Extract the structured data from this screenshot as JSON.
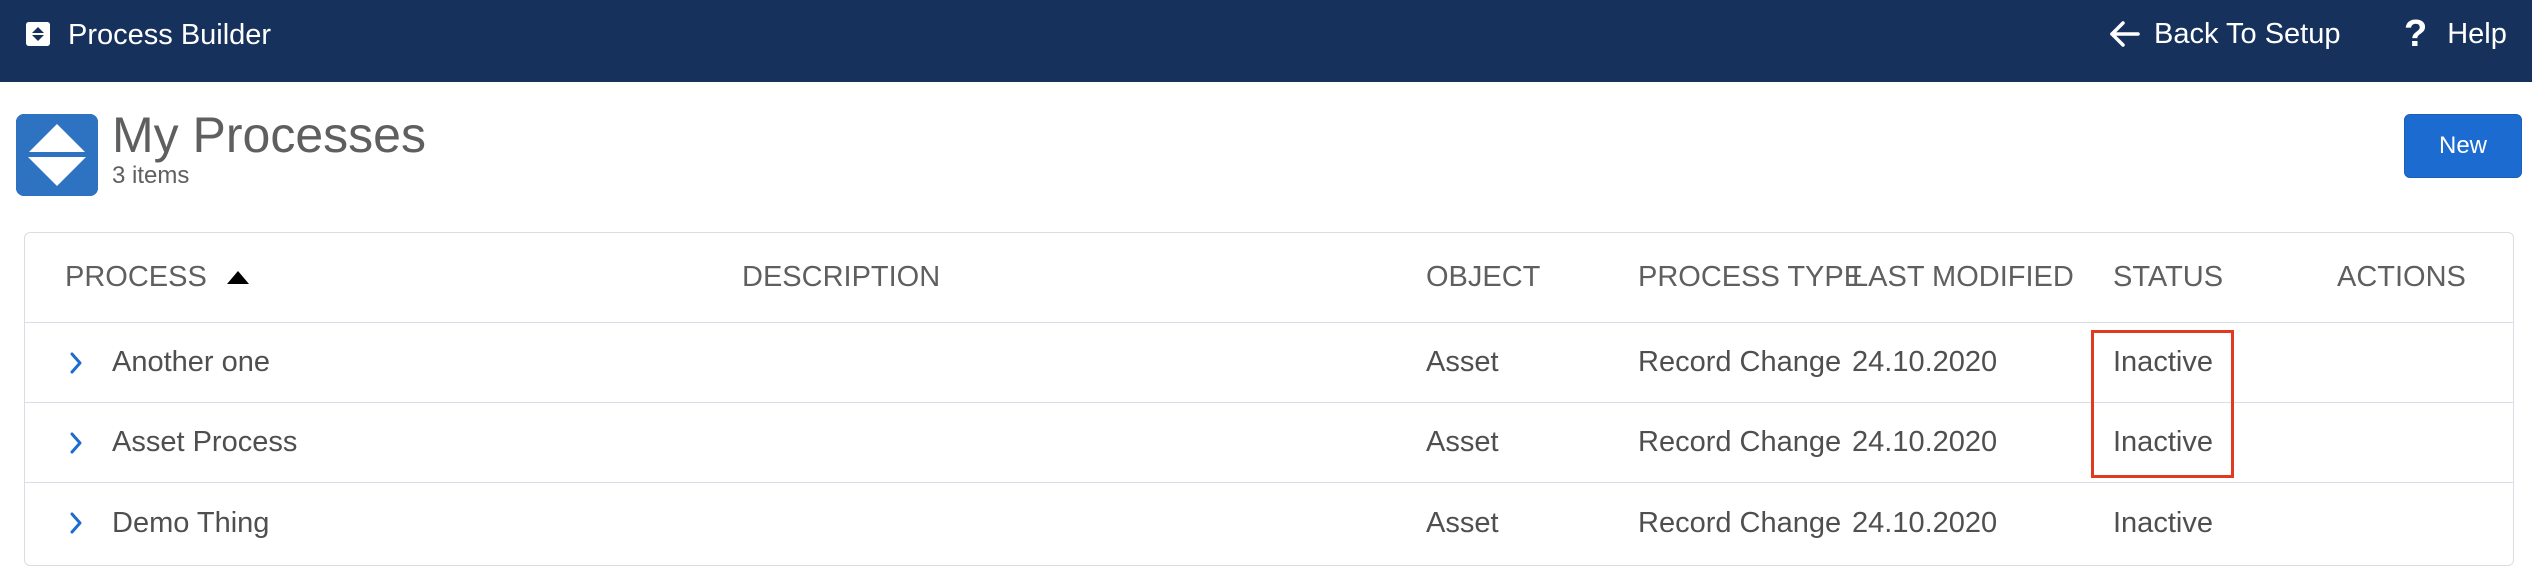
{
  "topbar": {
    "app_title": "Process Builder",
    "app_icon": "process-builder-icon",
    "back_label": "Back To Setup",
    "back_icon": "arrow-left-icon",
    "help_label": "Help",
    "help_icon": "question-mark-icon",
    "background_color": "#16325c"
  },
  "header": {
    "title": "My Processes",
    "count": "3 items",
    "icon": "process-diamond-icon",
    "icon_color": "#2e72c2",
    "new_button_label": "New",
    "new_button_color": "#1b6bd0"
  },
  "table": {
    "columns": {
      "process": "PROCESS",
      "description": "DESCRIPTION",
      "object": "OBJECT",
      "process_type": "PROCESS TYPE",
      "last_modified": "LAST MODIFIED",
      "status": "STATUS",
      "actions": "ACTIONS"
    },
    "sort": {
      "column": "PROCESS",
      "direction": "ascending",
      "icon": "sort-up-triangle-icon"
    },
    "rows": [
      {
        "process": "Another one",
        "description": "",
        "object": "Asset",
        "process_type": "Record Change",
        "last_modified": "24.10.2020",
        "status": "Inactive",
        "actions": ""
      },
      {
        "process": "Asset Process",
        "description": "",
        "object": "Asset",
        "process_type": "Record Change",
        "last_modified": "24.10.2020",
        "status": "Inactive",
        "actions": ""
      },
      {
        "process": "Demo Thing",
        "description": "",
        "object": "Asset",
        "process_type": "Record Change",
        "last_modified": "24.10.2020",
        "status": "Inactive",
        "actions": ""
      }
    ],
    "expand_icon": "chevron-right-icon"
  },
  "annotation": {
    "highlight_color": "#e03a20"
  }
}
